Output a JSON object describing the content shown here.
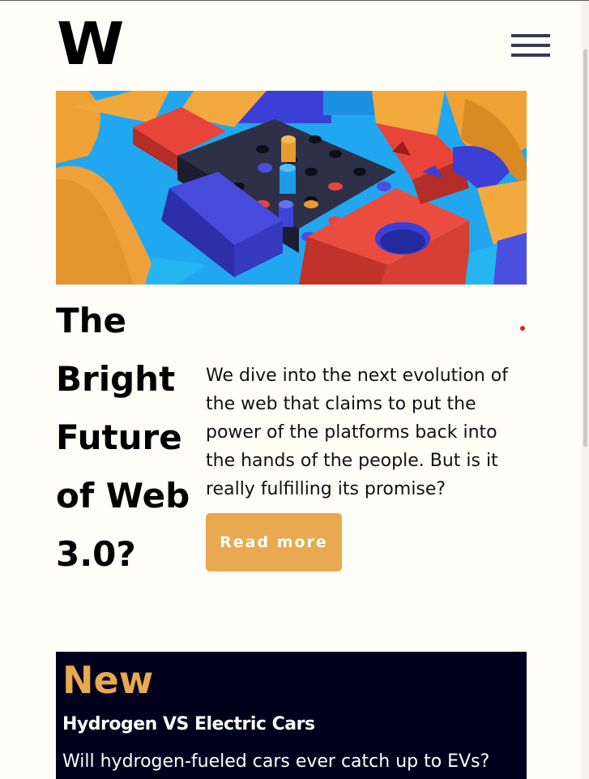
{
  "header": {
    "logo_text": "W",
    "menu_icon": "hamburger-menu-icon"
  },
  "hero": {
    "image_description": "abstract 3D geometric blocks illustration"
  },
  "article": {
    "title": "The Bright Future of Web 3.0?",
    "intro": "We dive into the next evolution of the web that claims to put the power of the platforms back into the hands of the people. But is it really fulfilling its promise?",
    "read_more_label": "Read more"
  },
  "new_section": {
    "heading": "New",
    "article_title": "Hydrogen VS Electric Cars",
    "article_description": "Will hydrogen-fueled cars ever catch up to EVs?"
  },
  "colors": {
    "background": "#fffdf8",
    "accent": "#e8a950",
    "panel_dark": "#00001c",
    "menu_bars": "#363a55",
    "dot": "#e32020"
  }
}
